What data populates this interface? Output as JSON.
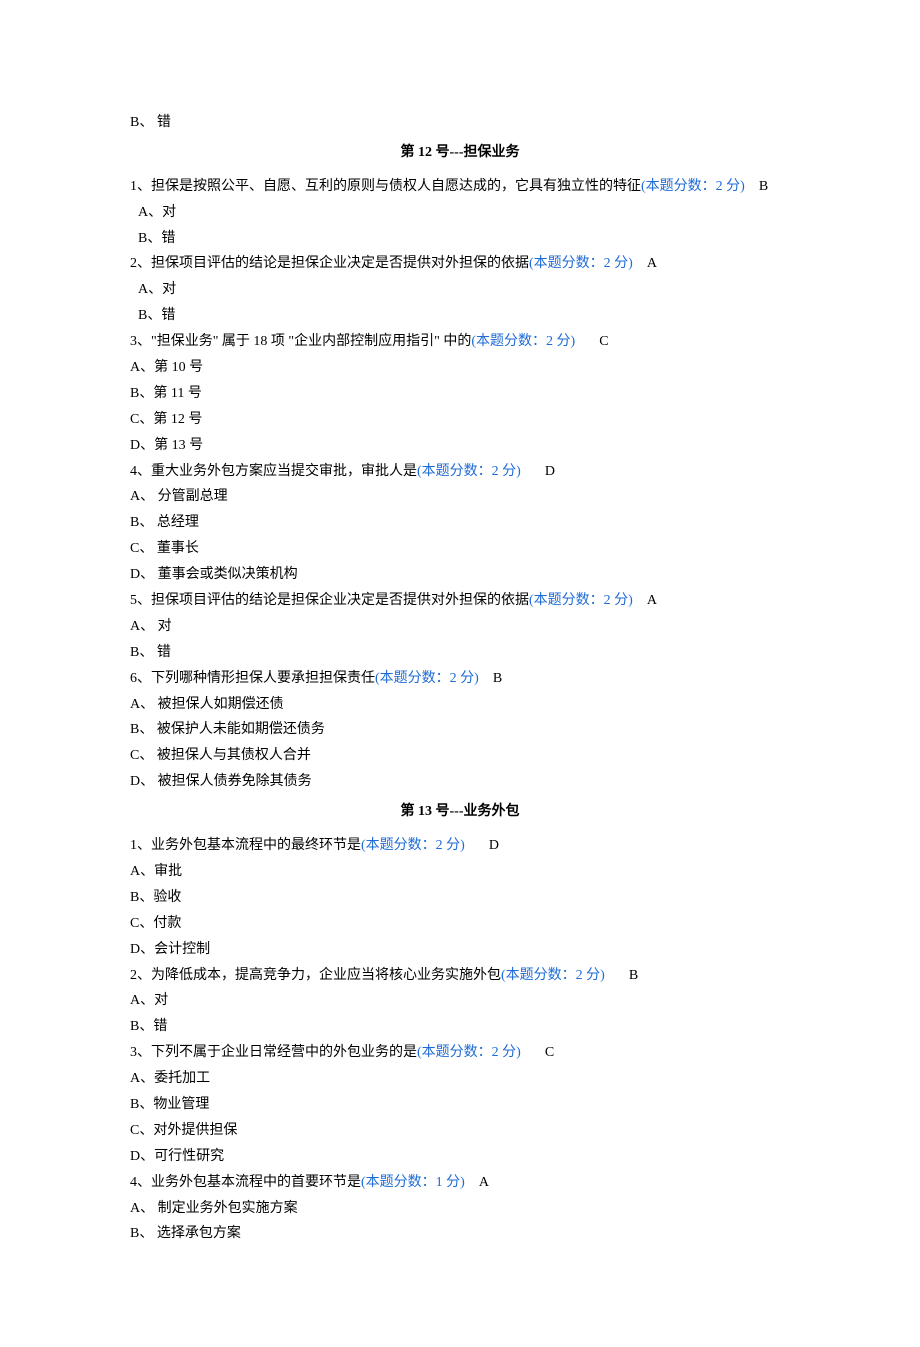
{
  "top_option": "B、 错",
  "section12": {
    "title": "第 12 号---担保业务",
    "q1": {
      "stem": "1、担保是按照公平、自愿、互利的原则与债权人自愿达成的，它具有独立性的特征",
      "score": "(本题分数：2 分)",
      "answer": "B",
      "optA": "A、对",
      "optB": "B、错"
    },
    "q2": {
      "stem": "2、担保项目评估的结论是担保企业决定是否提供对外担保的依据",
      "score": "(本题分数：2 分)",
      "answer": "A",
      "optA": "A、对",
      "optB": "B、错"
    },
    "q3": {
      "stem": "3、\"担保业务\" 属于 18 项 \"企业内部控制应用指引\" 中的",
      "score": "(本题分数：2 分)",
      "answer": "C",
      "optA": "A、第 10 号",
      "optB": "B、第 11 号",
      "optC": "C、第 12 号",
      "optD": "D、第 13 号"
    },
    "q4": {
      "stem": "4、重大业务外包方案应当提交审批，审批人是",
      "score": "(本题分数：2 分)",
      "answer": "D",
      "optA": "A、 分管副总理",
      "optB": "B、 总经理",
      "optC": "C、 董事长",
      "optD": "D、 董事会或类似决策机构"
    },
    "q5": {
      "stem": "5、担保项目评估的结论是担保企业决定是否提供对外担保的依据",
      "score": "(本题分数：2 分)",
      "answer": "A",
      "optA": "A、 对",
      "optB": "B、 错"
    },
    "q6": {
      "stem": "6、下列哪种情形担保人要承担担保责任",
      "score": "(本题分数：2 分)",
      "answer": "B",
      "optA": "A、 被担保人如期偿还债",
      "optB": "B、 被保护人未能如期偿还债务",
      "optC": "C、 被担保人与其债权人合并",
      "optD": "D、 被担保人债券免除其债务"
    }
  },
  "section13": {
    "title": "第 13 号---业务外包",
    "q1": {
      "stem": "1、业务外包基本流程中的最终环节是",
      "score": "(本题分数：2 分)",
      "answer": "D",
      "optA": "A、审批",
      "optB": "B、验收",
      "optC": "C、付款",
      "optD": "D、会计控制"
    },
    "q2": {
      "stem": "2、为降低成本，提高竞争力，企业应当将核心业务实施外包",
      "score": "(本题分数：2 分)",
      "answer": "B",
      "optA": "A、对",
      "optB": "B、错"
    },
    "q3": {
      "stem": "3、下列不属于企业日常经营中的外包业务的是",
      "score": "(本题分数：2 分)",
      "answer": "C",
      "optA": "A、委托加工",
      "optB": "B、物业管理",
      "optC": "C、对外提供担保",
      "optD": "D、可行性研究"
    },
    "q4": {
      "stem": "4、业务外包基本流程中的首要环节是",
      "score": "(本题分数：1 分)",
      "answer": "A",
      "optA": "A、 制定业务外包实施方案",
      "optB": "B、 选择承包方案"
    }
  }
}
